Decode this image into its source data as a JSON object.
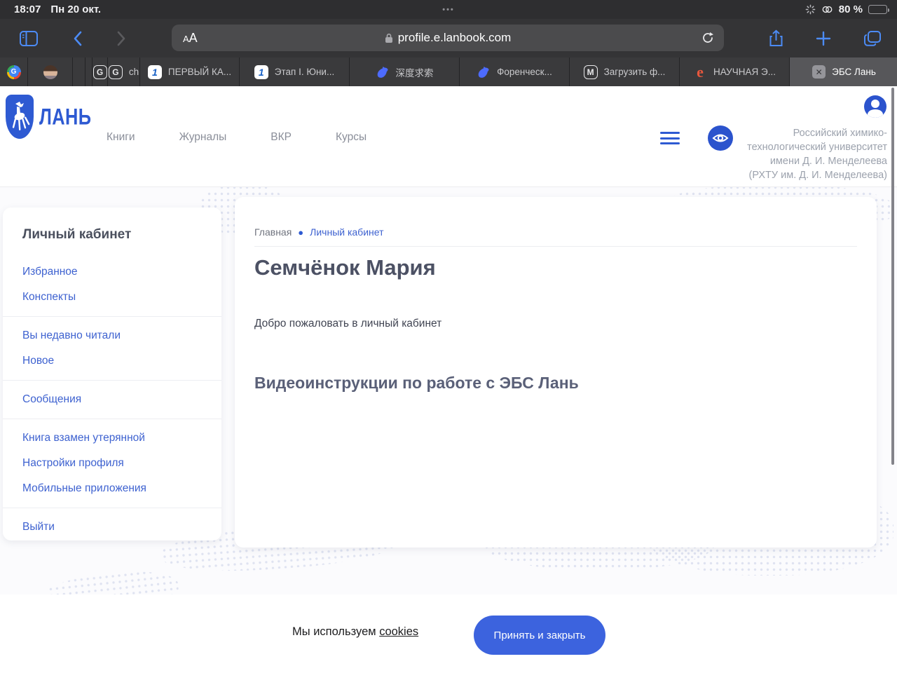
{
  "status_bar": {
    "time": "18:07",
    "date": "Пн 20 окт.",
    "battery_percent": "80 %",
    "multitask_dots": "•••"
  },
  "toolbar": {
    "reader_a_small": "А",
    "reader_a_large": "А",
    "url": "profile.e.lanbook.com"
  },
  "tabs": [
    {
      "label": ""
    },
    {
      "label": ""
    },
    {
      "label": ""
    },
    {
      "label": ""
    },
    {
      "label": ""
    },
    {
      "label": "ch"
    },
    {
      "label": "ПЕРВЫЙ КА...",
      "favicon_one": "1"
    },
    {
      "label": "Этап I. Юни...",
      "favicon_one": "1"
    },
    {
      "label": "深度求索"
    },
    {
      "label": "Форенческ..."
    },
    {
      "label": "Загрузить ф...",
      "favicon_m": "M"
    },
    {
      "label": "НАУЧНАЯ Э...",
      "favicon_e": "e"
    },
    {
      "label": "ЭБС Лань",
      "close_glyph": "✕"
    }
  ],
  "tab_favicons": {
    "g_letter": "G",
    "google_letter": "G",
    "m_letter": "M",
    "e_letter": "e",
    "one_digit": "1"
  },
  "site_header": {
    "logo_text": "ЛАНЬ",
    "nav": [
      {
        "label": "Книги"
      },
      {
        "label": "Журналы"
      },
      {
        "label": "ВКР"
      },
      {
        "label": "Курсы"
      }
    ],
    "university": "Российский химико-технологический университет имени Д. И. Менделеева (РХТУ им. Д. И. Менделеева)"
  },
  "sidebar": {
    "title": "Личный кабинет",
    "items": [
      "Избранное",
      "Конспекты",
      "Вы недавно читали",
      "Новое",
      "Сообщения",
      "Книга взамен утерянной",
      "Настройки профиля",
      "Мобильные приложения",
      "Выйти"
    ]
  },
  "main": {
    "breadcrumb": {
      "home": "Главная",
      "sep": "●",
      "current": "Личный кабинет"
    },
    "title": "Семчёнок Мария",
    "welcome": "Добро пожаловать в личный кабинет",
    "section_title": "Видеоинструкции по работе с ЭБС Лань"
  },
  "cookie_banner": {
    "text": "Мы используем",
    "link": "cookies",
    "button": "Принять и закрыть"
  },
  "colors": {
    "brand_blue": "#2e5ad2",
    "link_blue": "#3e62d0",
    "button_blue": "#3c63de",
    "ios_accent_blue": "#4c8bf5",
    "chrome_dark": "#343436",
    "active_tab": "#57575a"
  }
}
